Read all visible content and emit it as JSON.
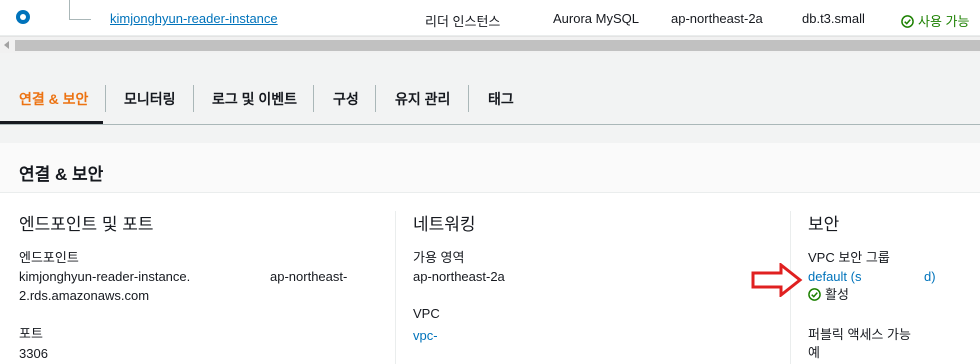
{
  "row": {
    "instance_name": "kimjonghyun-reader-instance",
    "role": "리더 인스턴스",
    "engine": "Aurora MySQL",
    "region": "ap-northeast-2a",
    "size": "db.t3.small",
    "status": "사용 가능",
    "status_color": "#1d8102",
    "link_color": "#0073bb"
  },
  "tabs": [
    {
      "label": "연결 & 보안",
      "active": true
    },
    {
      "label": "모니터링"
    },
    {
      "label": "로그 및 이벤트"
    },
    {
      "label": "구성"
    },
    {
      "label": "유지 관리"
    },
    {
      "label": "태그"
    }
  ],
  "accent_color": "#ec7211",
  "panel": {
    "title": "연결 & 보안",
    "endpoint_section": {
      "title": "엔드포인트 및 포트",
      "endpoint_label": "엔드포인트",
      "endpoint_line1_a": "kimjonghyun-reader-instance.",
      "endpoint_line1_b": "ap-northeast-",
      "endpoint_line2": "2.rds.amazonaws.com",
      "port_label": "포트",
      "port_value": "3306"
    },
    "network_section": {
      "title": "네트워킹",
      "az_label": "가용 영역",
      "az_value": "ap-northeast-2a",
      "vpc_label": "VPC",
      "vpc_value": "vpc-"
    },
    "security_section": {
      "title": "보안",
      "sg_label": "VPC 보안 그룹",
      "sg_value_a": "default (s",
      "sg_value_b": "d)",
      "sg_status": "활성",
      "public_label": "퍼블릭 액세스 가능",
      "public_value": "예"
    }
  },
  "annotation_arrow_color": "#e02020"
}
